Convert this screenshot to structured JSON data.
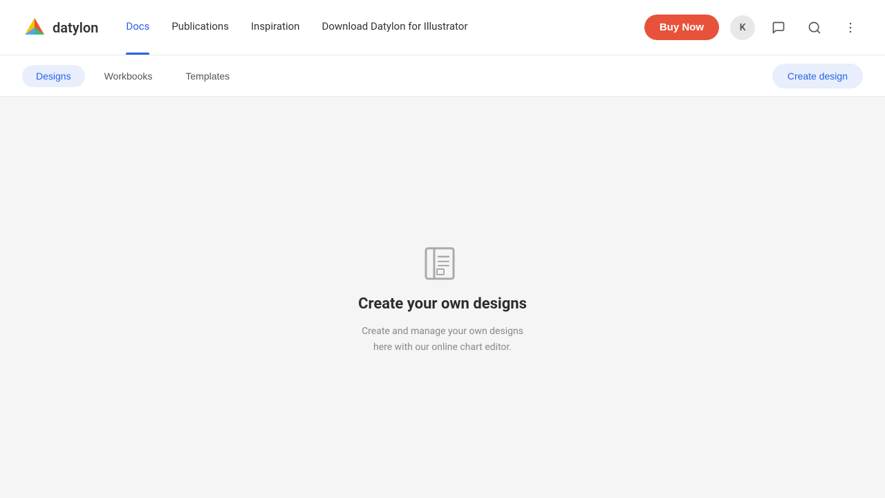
{
  "brand": {
    "name": "datylon"
  },
  "navbar": {
    "links": [
      {
        "label": "Docs",
        "active": true
      },
      {
        "label": "Publications",
        "active": false
      },
      {
        "label": "Inspiration",
        "active": false
      },
      {
        "label": "Download Datylon for Illustrator",
        "active": false
      }
    ],
    "buy_now_label": "Buy Now",
    "avatar_initials": "K"
  },
  "sub_header": {
    "tabs": [
      {
        "label": "Designs",
        "active": true
      },
      {
        "label": "Workbooks",
        "active": false
      },
      {
        "label": "Templates",
        "active": false
      }
    ],
    "create_design_label": "Create design"
  },
  "empty_state": {
    "title": "Create your own designs",
    "description": "Create and manage your own designs here with our online chart editor."
  },
  "icons": {
    "chat": "💬",
    "search": "🔍",
    "more": "⋮"
  }
}
